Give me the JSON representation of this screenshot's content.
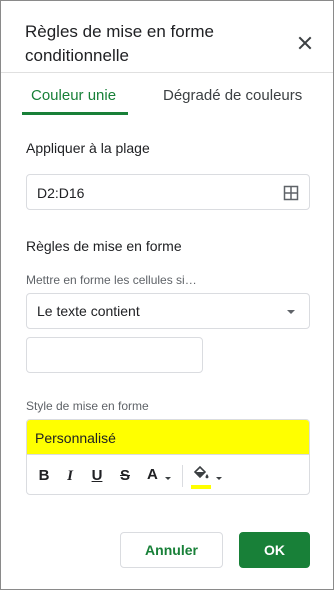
{
  "dialog": {
    "title": "Règles de mise en forme conditionnelle",
    "close_icon": "close-icon"
  },
  "tabs": [
    {
      "label": "Couleur unie",
      "active": true
    },
    {
      "label": "Dégradé de couleurs",
      "active": false
    }
  ],
  "range": {
    "label": "Appliquer à la plage",
    "value": "D2:D16",
    "icon": "grid-select-icon"
  },
  "rules": {
    "label": "Règles de mise en forme",
    "condition_label": "Mettre en forme les cellules si…",
    "condition_value": "Le texte contient",
    "input_value": ""
  },
  "style": {
    "label": "Style de mise en forme",
    "preview_text": "Personnalisé",
    "preview_bg": "#ffff00",
    "toolbar": {
      "bold": "B",
      "italic": "I",
      "underline": "U",
      "strikethrough": "S",
      "text_color": "A",
      "fill_color": "#ffff00"
    }
  },
  "actions": {
    "cancel": "Annuler",
    "ok": "OK"
  },
  "colors": {
    "accent": "#188038",
    "border": "#dadce0"
  }
}
